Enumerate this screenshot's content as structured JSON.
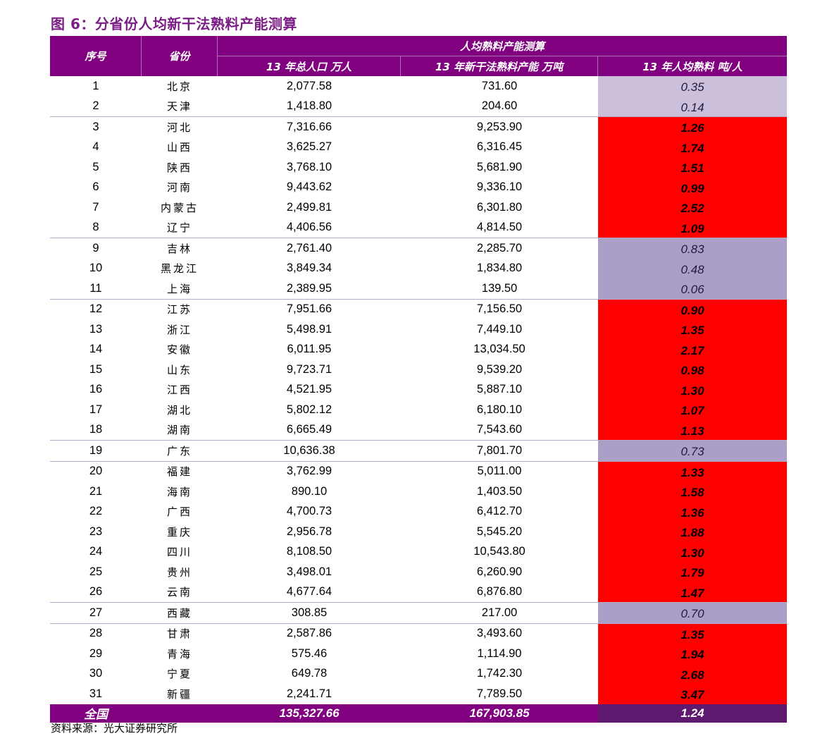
{
  "title": "图 6：分省份人均新干法熟料产能测算",
  "header": {
    "col_no": "序号",
    "col_province": "省份",
    "group": "人均熟料产能测算",
    "col_population": "13 年总人口 万人",
    "col_capacity": "13 年新干法熟料产能 万吨",
    "col_per_capita": "13 年人均熟料 吨/人"
  },
  "rows": [
    {
      "no": "1",
      "province": "北京",
      "population": "2,077.58",
      "capacity": "731.60",
      "per_capita": "0.35",
      "level": "low"
    },
    {
      "no": "2",
      "province": "天津",
      "population": "1,418.80",
      "capacity": "204.60",
      "per_capita": "0.14",
      "level": "low"
    },
    {
      "no": "3",
      "province": "河北",
      "population": "7,316.66",
      "capacity": "9,253.90",
      "per_capita": "1.26",
      "level": "high"
    },
    {
      "no": "4",
      "province": "山西",
      "population": "3,625.27",
      "capacity": "6,316.45",
      "per_capita": "1.74",
      "level": "high"
    },
    {
      "no": "5",
      "province": "陕西",
      "population": "3,768.10",
      "capacity": "5,681.90",
      "per_capita": "1.51",
      "level": "high"
    },
    {
      "no": "6",
      "province": "河南",
      "population": "9,443.62",
      "capacity": "9,336.10",
      "per_capita": "0.99",
      "level": "high"
    },
    {
      "no": "7",
      "province": "内蒙古",
      "population": "2,499.81",
      "capacity": "6,301.80",
      "per_capita": "2.52",
      "level": "high"
    },
    {
      "no": "8",
      "province": "辽宁",
      "population": "4,406.56",
      "capacity": "4,814.50",
      "per_capita": "1.09",
      "level": "high"
    },
    {
      "no": "9",
      "province": "吉林",
      "population": "2,761.40",
      "capacity": "2,285.70",
      "per_capita": "0.83",
      "level": "mid"
    },
    {
      "no": "10",
      "province": "黑龙江",
      "population": "3,849.34",
      "capacity": "1,834.80",
      "per_capita": "0.48",
      "level": "mid"
    },
    {
      "no": "11",
      "province": "上海",
      "population": "2,389.95",
      "capacity": "139.50",
      "per_capita": "0.06",
      "level": "mid"
    },
    {
      "no": "12",
      "province": "江苏",
      "population": "7,951.66",
      "capacity": "7,156.50",
      "per_capita": "0.90",
      "level": "high"
    },
    {
      "no": "13",
      "province": "浙江",
      "population": "5,498.91",
      "capacity": "7,449.10",
      "per_capita": "1.35",
      "level": "high"
    },
    {
      "no": "14",
      "province": "安徽",
      "population": "6,011.95",
      "capacity": "13,034.50",
      "per_capita": "2.17",
      "level": "high"
    },
    {
      "no": "15",
      "province": "山东",
      "population": "9,723.71",
      "capacity": "9,539.20",
      "per_capita": "0.98",
      "level": "high"
    },
    {
      "no": "16",
      "province": "江西",
      "population": "4,521.95",
      "capacity": "5,887.10",
      "per_capita": "1.30",
      "level": "high"
    },
    {
      "no": "17",
      "province": "湖北",
      "population": "5,802.12",
      "capacity": "6,180.10",
      "per_capita": "1.07",
      "level": "high"
    },
    {
      "no": "18",
      "province": "湖南",
      "population": "6,665.49",
      "capacity": "7,543.60",
      "per_capita": "1.13",
      "level": "high"
    },
    {
      "no": "19",
      "province": "广东",
      "population": "10,636.38",
      "capacity": "7,801.70",
      "per_capita": "0.73",
      "level": "mid"
    },
    {
      "no": "20",
      "province": "福建",
      "population": "3,762.99",
      "capacity": "5,011.00",
      "per_capita": "1.33",
      "level": "high"
    },
    {
      "no": "21",
      "province": "海南",
      "population": "890.10",
      "capacity": "1,403.50",
      "per_capita": "1.58",
      "level": "high"
    },
    {
      "no": "22",
      "province": "广西",
      "population": "4,700.73",
      "capacity": "6,412.70",
      "per_capita": "1.36",
      "level": "high"
    },
    {
      "no": "23",
      "province": "重庆",
      "population": "2,956.78",
      "capacity": "5,545.20",
      "per_capita": "1.88",
      "level": "high"
    },
    {
      "no": "24",
      "province": "四川",
      "population": "8,108.50",
      "capacity": "10,543.80",
      "per_capita": "1.30",
      "level": "high"
    },
    {
      "no": "25",
      "province": "贵州",
      "population": "3,498.01",
      "capacity": "6,260.90",
      "per_capita": "1.79",
      "level": "high"
    },
    {
      "no": "26",
      "province": "云南",
      "population": "4,677.64",
      "capacity": "6,876.80",
      "per_capita": "1.47",
      "level": "high"
    },
    {
      "no": "27",
      "province": "西藏",
      "population": "308.85",
      "capacity": "217.00",
      "per_capita": "0.70",
      "level": "mid"
    },
    {
      "no": "28",
      "province": "甘肃",
      "population": "2,587.86",
      "capacity": "3,493.60",
      "per_capita": "1.35",
      "level": "high"
    },
    {
      "no": "29",
      "province": "青海",
      "population": "575.46",
      "capacity": "1,114.90",
      "per_capita": "1.94",
      "level": "high"
    },
    {
      "no": "30",
      "province": "宁夏",
      "population": "649.78",
      "capacity": "1,742.30",
      "per_capita": "2.68",
      "level": "high"
    },
    {
      "no": "31",
      "province": "新疆",
      "population": "2,241.71",
      "capacity": "7,789.50",
      "per_capita": "3.47",
      "level": "high"
    }
  ],
  "total": {
    "label": "全国",
    "population": "135,327.66",
    "capacity": "167,903.85",
    "per_capita": "1.24"
  },
  "colors": {
    "header_bg": "#800080",
    "title": "#7b1f86",
    "high": "#ff0000",
    "mid": "#ab9fc8",
    "low": "#cbbfdc",
    "total_value_bg": "#5e1a6e"
  },
  "footer": "资料来源：光大证券研究所"
}
